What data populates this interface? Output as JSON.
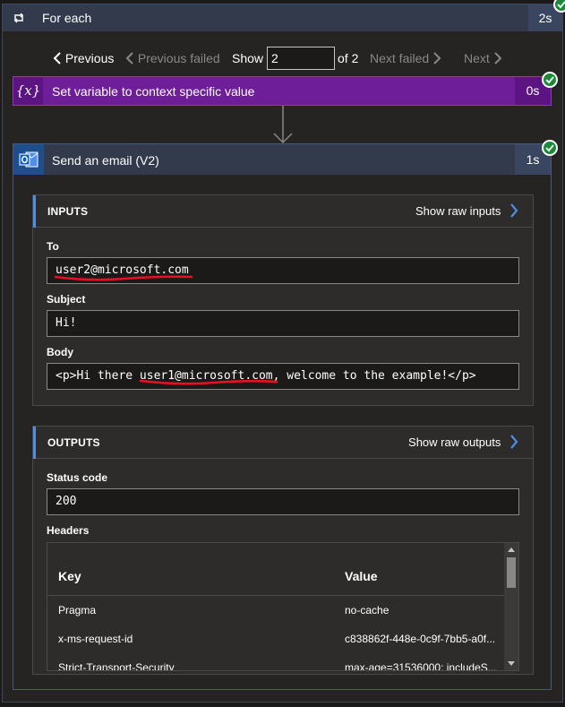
{
  "foreach": {
    "title": "For each",
    "duration": "2s"
  },
  "pager": {
    "previous": "Previous",
    "previous_failed": "Previous failed",
    "show_label": "Show",
    "show_value": "2",
    "of_label": "of 2",
    "next_failed": "Next failed",
    "next": "Next"
  },
  "set_variable": {
    "icon_text": "{x}",
    "title": "Set variable to context specific value",
    "duration": "0s"
  },
  "send_email": {
    "title": "Send an email (V2)",
    "duration": "1s",
    "inputs": {
      "title": "INPUTS",
      "raw_link": "Show raw inputs",
      "fields": [
        {
          "label": "To",
          "value": "user2@microsoft.com"
        },
        {
          "label": "Subject",
          "value": "Hi!"
        },
        {
          "label": "Body",
          "value": "<p>Hi there user1@microsoft.com, welcome to the example!</p>"
        }
      ]
    },
    "outputs": {
      "title": "OUTPUTS",
      "raw_link": "Show raw outputs",
      "status_label": "Status code",
      "status_value": "200",
      "headers_label": "Headers",
      "headers_columns": {
        "key": "Key",
        "value": "Value"
      },
      "headers_rows": [
        {
          "key": "Pragma",
          "value": "no-cache"
        },
        {
          "key": "x-ms-request-id",
          "value": "c838862f-448e-0c9f-7bb5-a0f..."
        },
        {
          "key": "Strict-Transport-Security",
          "value": "max-age=31536000; includeS..."
        }
      ]
    }
  },
  "colors": {
    "success": "#1a8a3a",
    "set_variable_bg": "#6e1e99",
    "accent": "#4f8ee8",
    "annotation": "#e81123"
  }
}
